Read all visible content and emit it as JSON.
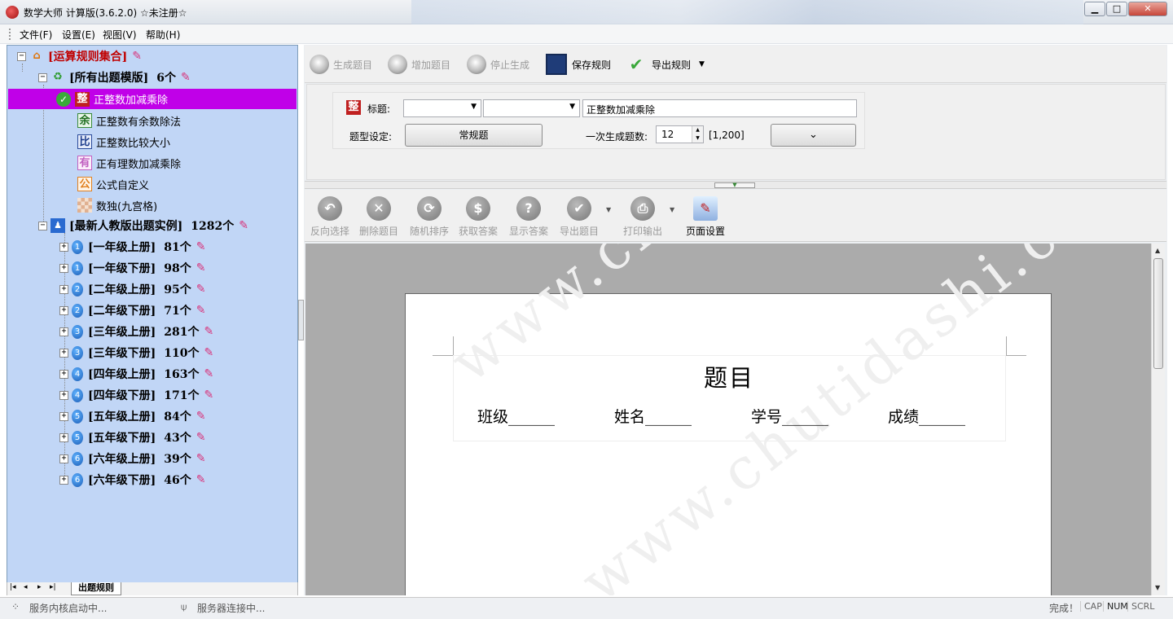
{
  "window": {
    "title": "数学大师 计算版(3.6.2.0) ☆未注册☆",
    "controls": [
      "▁",
      "□",
      "✕"
    ]
  },
  "menu": [
    "文件(F)",
    "设置(E)",
    "视图(V)",
    "帮助(H)"
  ],
  "tree": {
    "root": "[运算规则集合]",
    "templates": {
      "label": "[所有出题模版]",
      "count": "6个"
    },
    "template_items": [
      {
        "icon": "整",
        "label": "正整数加减乘除",
        "selected": true
      },
      {
        "icon": "余",
        "label": "正整数有余数除法"
      },
      {
        "icon": "比",
        "label": "正整数比较大小"
      },
      {
        "icon": "有",
        "label": "正有理数加减乘除"
      },
      {
        "icon": "公",
        "label": "公式自定义"
      },
      {
        "icon": "",
        "label": "数独(九宫格)"
      }
    ],
    "examples": {
      "label": "[最新人教版出题实例]",
      "count": "1282个"
    },
    "grades": [
      {
        "num": "1",
        "label": "[一年级上册]",
        "count": "81个"
      },
      {
        "num": "1",
        "label": "[一年级下册]",
        "count": "98个"
      },
      {
        "num": "2",
        "label": "[二年级上册]",
        "count": "95个"
      },
      {
        "num": "2",
        "label": "[二年级下册]",
        "count": "71个"
      },
      {
        "num": "3",
        "label": "[三年级上册]",
        "count": "281个"
      },
      {
        "num": "3",
        "label": "[三年级下册]",
        "count": "110个"
      },
      {
        "num": "4",
        "label": "[四年级上册]",
        "count": "163个"
      },
      {
        "num": "4",
        "label": "[四年级下册]",
        "count": "171个"
      },
      {
        "num": "5",
        "label": "[五年级上册]",
        "count": "84个"
      },
      {
        "num": "5",
        "label": "[五年级下册]",
        "count": "43个"
      },
      {
        "num": "6",
        "label": "[六年级上册]",
        "count": "39个"
      },
      {
        "num": "6",
        "label": "[六年级下册]",
        "count": "46个"
      }
    ]
  },
  "bottom_tab": "出题规则",
  "tab_nav": [
    "|◂",
    "◂",
    "▸",
    "▸|"
  ],
  "toolbar1": {
    "generate": "生成题目",
    "add": "增加题目",
    "stop": "停止生成",
    "save": "保存规则",
    "export": "导出规则"
  },
  "settings": {
    "title_label": "标题:",
    "title_value": "正整数加减乘除",
    "type_label": "题型设定:",
    "type_button": "常规题",
    "count_label": "一次生成题数:",
    "count_value": "12",
    "count_range": "[1,200]"
  },
  "toolbar2": [
    "反向选择",
    "删除题目",
    "随机排序",
    "获取答案",
    "显示答案",
    "导出题目",
    "打印输出",
    "页面设置"
  ],
  "toolbar2_icons": [
    "↶",
    "✕",
    "⟳",
    "$",
    "?",
    "✔",
    "⎙",
    "✎"
  ],
  "document": {
    "heading": "题目",
    "fields": [
      "班级______",
      "姓名______",
      "学号______",
      "成绩______"
    ],
    "watermark": "www.chutidashi.com"
  },
  "status": {
    "left": "服务内核启动中...",
    "middle": "服务器连接中...",
    "right": "完成！",
    "indicators": [
      "CAP",
      "NUM",
      "SCRL"
    ]
  },
  "colors": {
    "tree_bg": "#c1d6f6",
    "selected_bg": "#c000e8",
    "root_text": "#c00000"
  }
}
